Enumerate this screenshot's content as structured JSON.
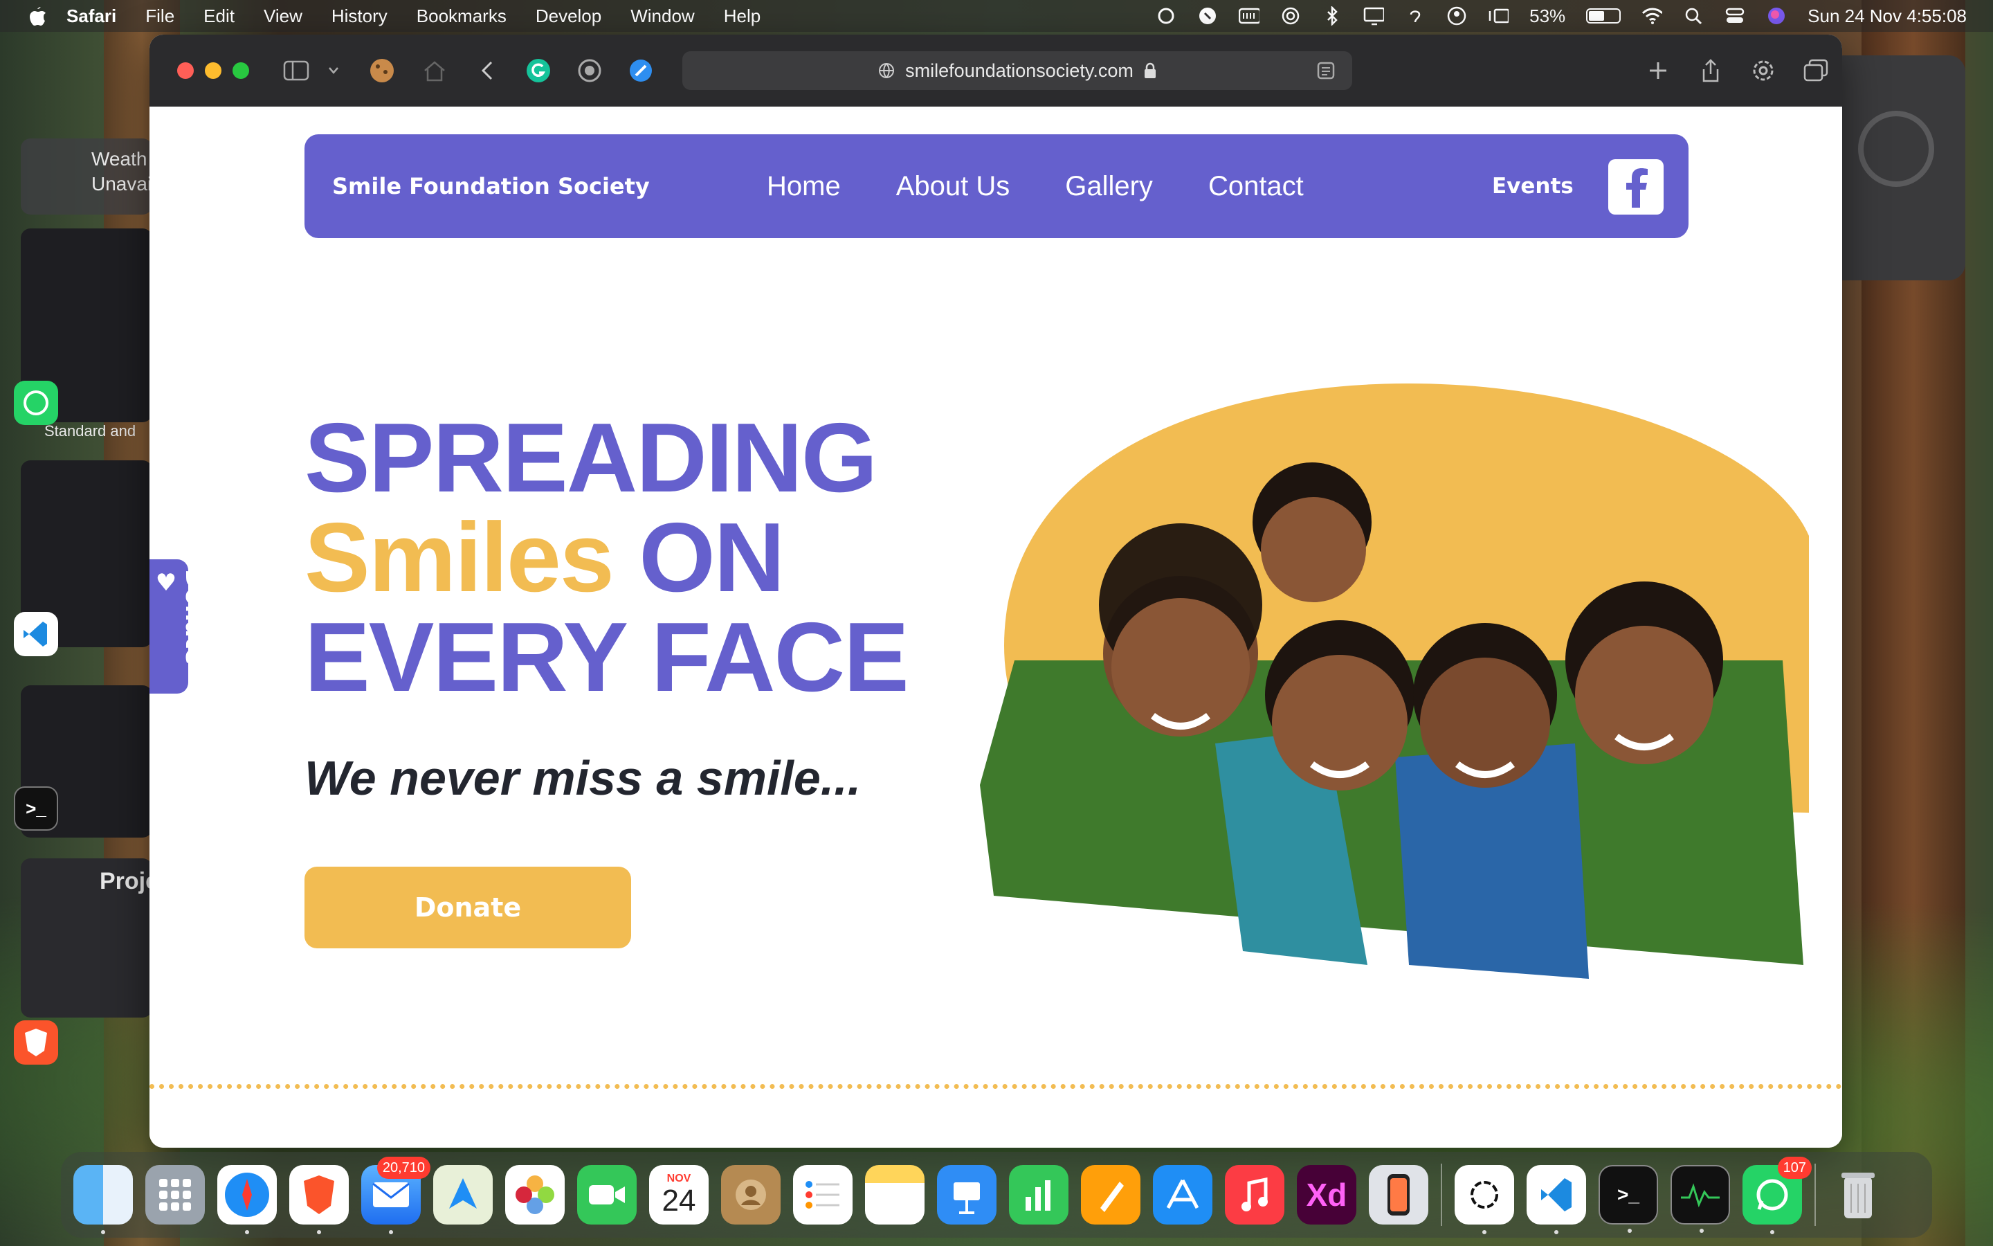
{
  "menubar": {
    "app_name": "Safari",
    "menus": [
      "File",
      "Edit",
      "View",
      "History",
      "Bookmarks",
      "Develop",
      "Window",
      "Help"
    ],
    "battery_percent": "53%",
    "battery_level": 0.53,
    "datetime": "Sun 24 Nov  4:55:08"
  },
  "stage_manager": {
    "weather_label": "Weath\nUnavai",
    "standard_label": "Standard and",
    "project_label": "Proje"
  },
  "browser": {
    "url": "smilefoundationsociety.com"
  },
  "site": {
    "brand": "Smile Foundation Society",
    "nav": [
      "Home",
      "About Us",
      "Gallery",
      "Contact"
    ],
    "events": "Events",
    "donate_tab": "Donate ♥",
    "hero_line1": "SPREADING",
    "hero_line2_accent": "Smiles",
    "hero_line2_rest": " ON",
    "hero_line3": "EVERY FACE",
    "tagline": "We never miss a smile...",
    "donate_button": "Donate",
    "colors": {
      "primary": "#6560cd",
      "accent": "#f2bc52",
      "text": "#23262f"
    }
  },
  "dock": {
    "mail_badge": "20,710",
    "calendar_month": "NOV",
    "calendar_day": "24",
    "xd_label": "Xd",
    "whatsapp_badge": "107",
    "icons": [
      "finder-icon",
      "launchpad-icon",
      "safari-icon",
      "brave-icon",
      "mail-icon",
      "maps-icon",
      "photos-icon",
      "facetime-icon",
      "calendar-icon",
      "contacts-icon",
      "reminders-icon",
      "notes-icon",
      "keynote-icon",
      "numbers-icon",
      "pages-icon",
      "app-store-icon",
      "music-icon",
      "xd-icon",
      "iphone-mirroring-icon",
      "chatgpt-icon",
      "vscode-icon",
      "terminal-icon",
      "activity-monitor-icon",
      "whatsapp-icon",
      "trash-icon"
    ]
  }
}
